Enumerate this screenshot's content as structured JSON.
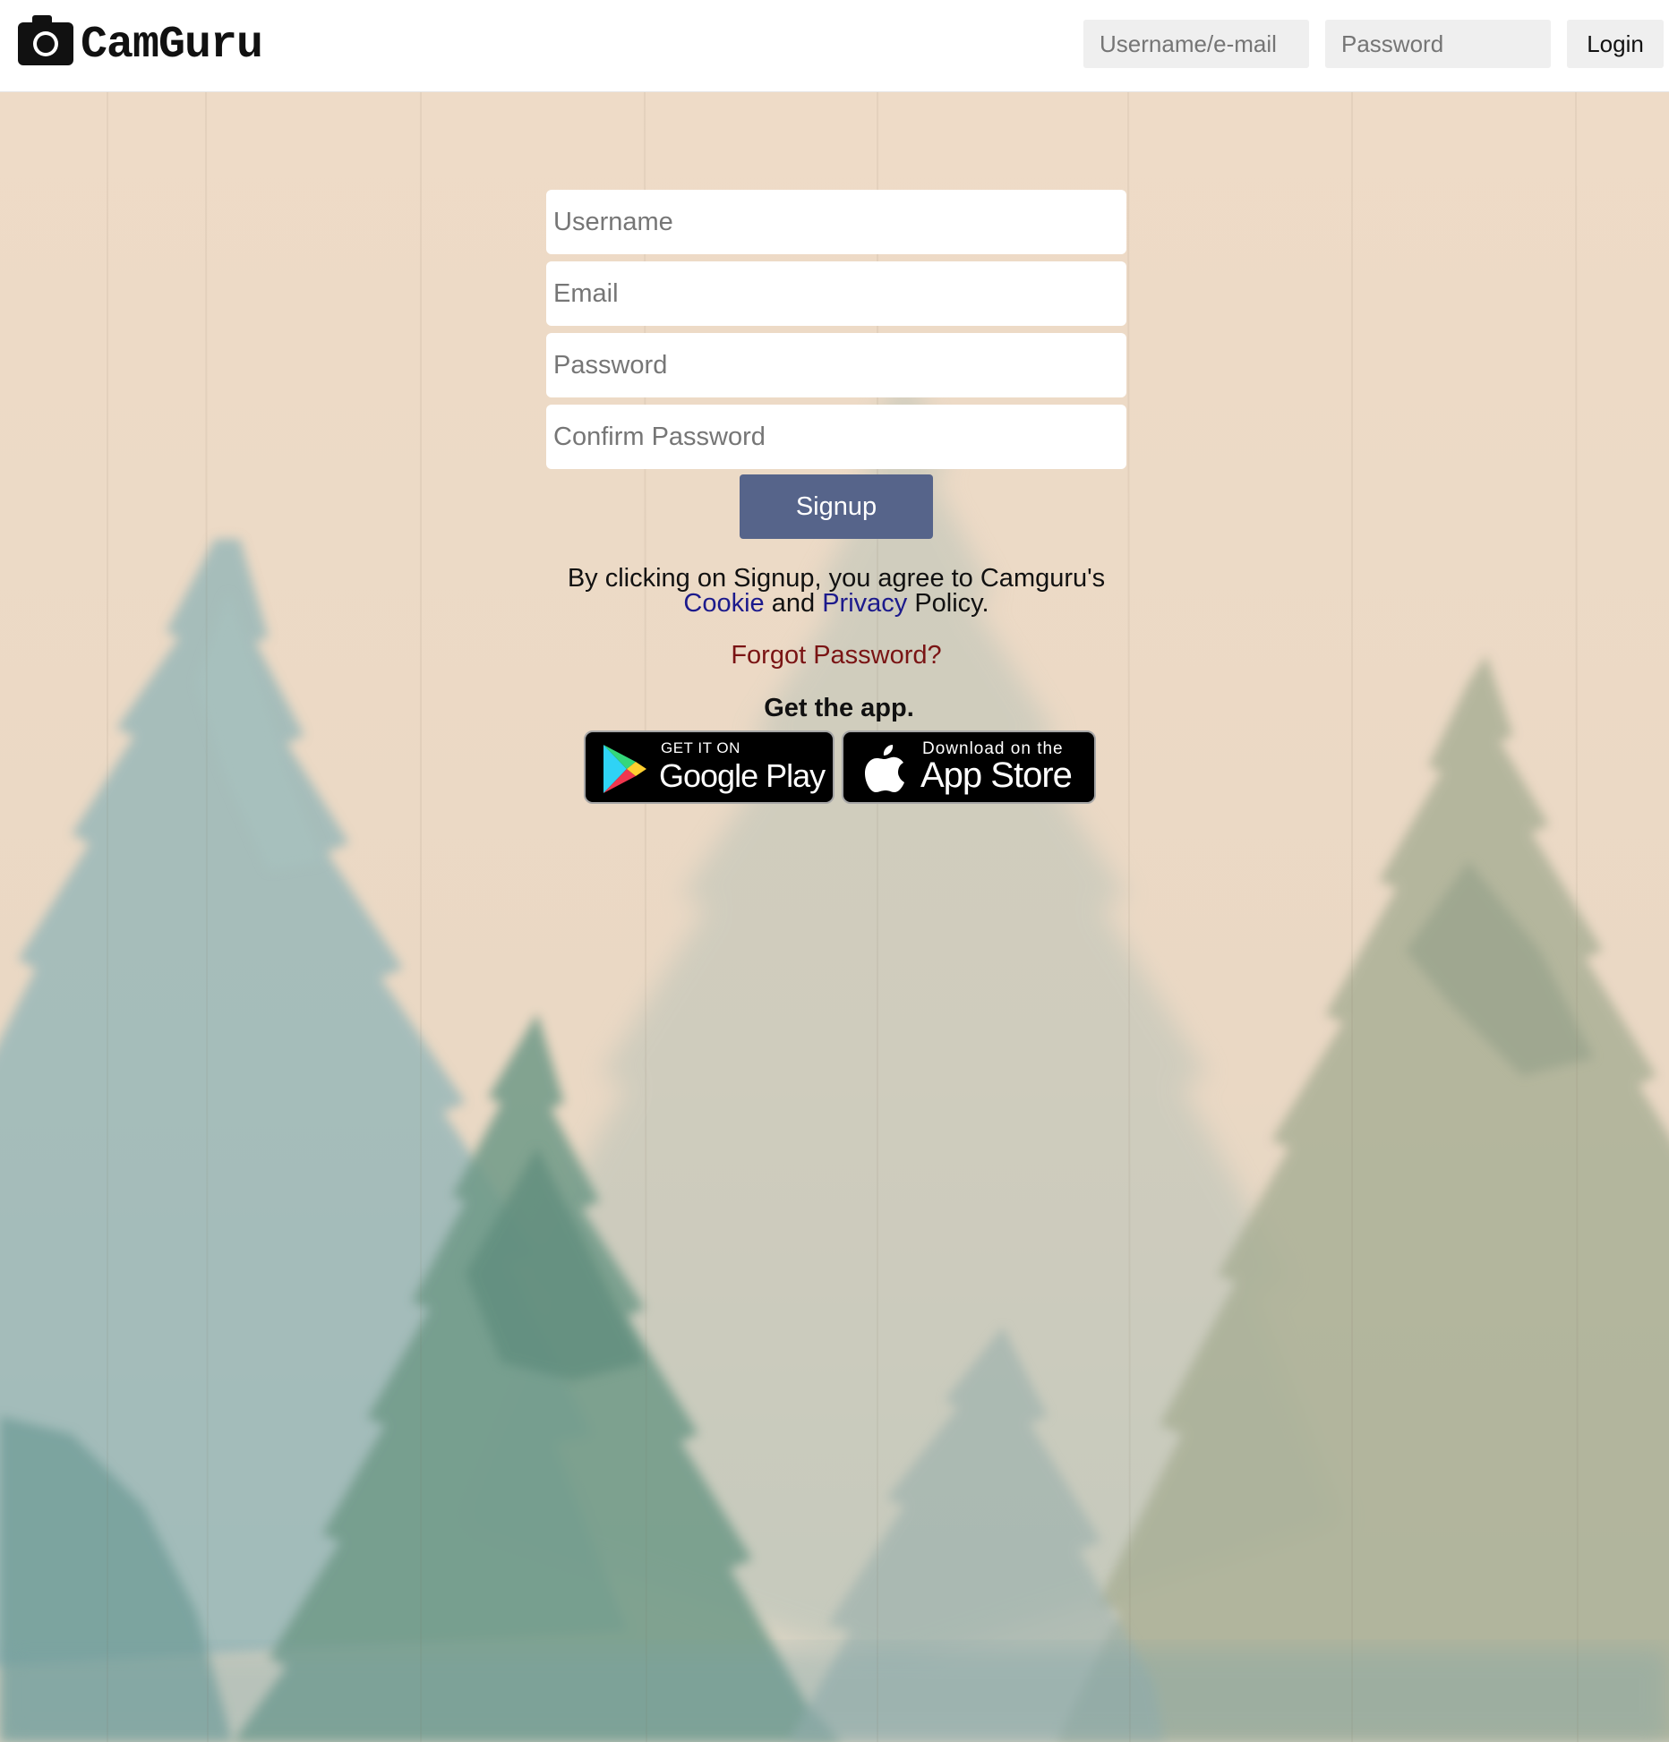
{
  "brand": {
    "name": "CamGuru",
    "logo_icon": "camera-icon"
  },
  "header": {
    "username_placeholder": "Username/e-mail",
    "password_placeholder": "Password",
    "login_label": "Login"
  },
  "signup_form": {
    "username_placeholder": "Username",
    "email_placeholder": "Email",
    "password_placeholder": "Password",
    "confirm_password_placeholder": "Confirm Password",
    "signup_label": "Signup"
  },
  "terms": {
    "line1": "By clicking on Signup, you agree to Camguru's",
    "cookie_link": "Cookie",
    "and_text": " and ",
    "privacy_link": "Privacy",
    "policy_text": " Policy."
  },
  "forgot_password": "Forgot Password?",
  "get_app": {
    "heading": "Get the app.",
    "google_play": {
      "small": "GET IT ON",
      "big": "Google Play",
      "icon": "google-play-icon"
    },
    "app_store": {
      "small": "Download on the",
      "big": "App Store",
      "icon": "apple-icon"
    }
  },
  "colors": {
    "header_bg": "#ffffff",
    "page_bg": "#efdcc9",
    "signup_button": "#56648a",
    "link_blue": "#1c1a8c",
    "forgot_red": "#7a1414"
  },
  "background": {
    "theme": "watercolor-pine-forest"
  }
}
